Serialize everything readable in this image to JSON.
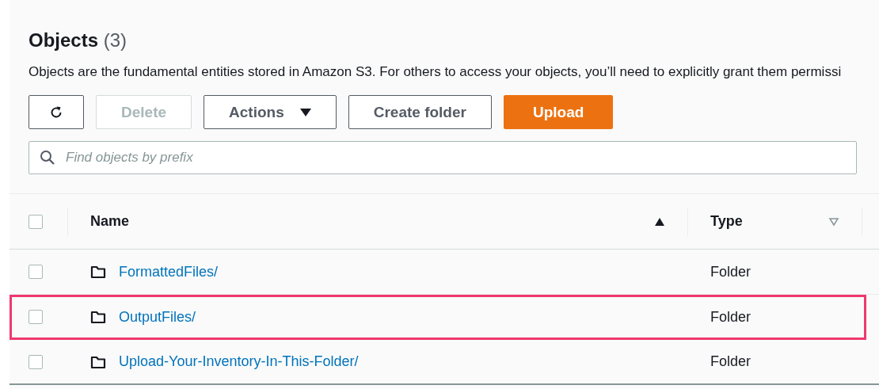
{
  "header": {
    "title": "Objects",
    "count": "(3)",
    "description": "Objects are the fundamental entities stored in Amazon S3. For others to access your objects, you’ll need to explicitly grant them permissi"
  },
  "toolbar": [
    {
      "kind": "refresh",
      "disabled": false
    },
    {
      "kind": "text",
      "label": "Delete",
      "disabled": true
    },
    {
      "kind": "dropdown",
      "label": "Actions",
      "disabled": false
    },
    {
      "kind": "text",
      "label": "Create folder",
      "disabled": false
    },
    {
      "kind": "primary",
      "label": "Upload",
      "disabled": false
    }
  ],
  "search": {
    "placeholder": "Find objects by prefix"
  },
  "table": {
    "select_all": {
      "checked": false
    },
    "columns": [
      {
        "label": "Name",
        "sorted": true
      },
      {
        "label": "Type",
        "sorted": false
      }
    ],
    "rows": [
      {
        "name": "FormattedFiles/",
        "type": "Folder",
        "checked": false,
        "highlighted": false
      },
      {
        "name": "OutputFiles/",
        "type": "Folder",
        "checked": false,
        "highlighted": true
      },
      {
        "name": "Upload-Your-Inventory-In-This-Folder/",
        "type": "Folder",
        "checked": false,
        "highlighted": false
      }
    ]
  }
}
